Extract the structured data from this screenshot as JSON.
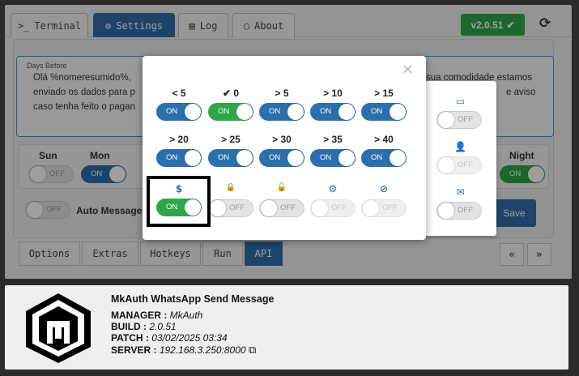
{
  "tabs": [
    {
      "icon": ">_",
      "label": "Terminal"
    },
    {
      "icon": "⚙",
      "label": "Settings"
    },
    {
      "icon": "▤",
      "label": "Log"
    },
    {
      "icon": "◯",
      "label": "About"
    }
  ],
  "version_badge": {
    "label": "v2.0.51",
    "icon": "check-icon",
    "color": "#2ea74a"
  },
  "message": {
    "label": "Days Before",
    "line1": "Olá %nomeresumido%,",
    "line1_right": "sua comodidade estamos",
    "line2": "enviado os dados para p",
    "line2_right": "e aviso",
    "line3": "caso tenha feito o pagan"
  },
  "days": {
    "sun": "Sun",
    "mon": "Mon",
    "night": "Night"
  },
  "toggle_text": {
    "on": "ON",
    "off": "OFF"
  },
  "auto_message_label": "Auto Message",
  "save_label": "Save",
  "bottom_tabs": [
    "Options",
    "Extras",
    "Hotkeys",
    "Run",
    "API"
  ],
  "nav": {
    "prev": "«",
    "next": "»"
  },
  "modal": {
    "close": "×",
    "row1": [
      {
        "arrow": "<",
        "value": "5",
        "state": "on"
      },
      {
        "arrow": "✔",
        "value": "0",
        "state": "green"
      },
      {
        "arrow": ">",
        "value": "5",
        "state": "on"
      },
      {
        "arrow": ">",
        "value": "10",
        "state": "on"
      },
      {
        "arrow": ">",
        "value": "15",
        "state": "on"
      }
    ],
    "row2": [
      {
        "arrow": ">",
        "value": "20",
        "state": "on"
      },
      {
        "arrow": ">",
        "value": "25",
        "state": "on"
      },
      {
        "arrow": ">",
        "value": "30",
        "state": "on"
      },
      {
        "arrow": ">",
        "value": "35",
        "state": "on"
      },
      {
        "arrow": ">",
        "value": "40",
        "state": "on"
      }
    ],
    "row3": [
      {
        "icon": "$",
        "name": "dollar-icon",
        "state": "green"
      },
      {
        "icon": "🔒",
        "name": "lock-icon",
        "state": "off"
      },
      {
        "icon": "🔓",
        "name": "unlock-icon",
        "state": "off"
      },
      {
        "icon": "⚙",
        "name": "gears-icon",
        "state": "off-dim"
      },
      {
        "icon": "⊘",
        "name": "ban-icon",
        "state": "off-dim"
      }
    ]
  },
  "side": [
    {
      "icon": "▭",
      "name": "battery-icon"
    },
    {
      "icon": "👤",
      "name": "user-times-icon"
    },
    {
      "icon": "✉",
      "name": "envelope-icon"
    }
  ],
  "info": {
    "title": "MkAuth WhatsApp Send Message",
    "manager_label": "MANAGER :",
    "manager_value": "MkAuth",
    "build_label": "BUILD :",
    "build_value": "2.0.51",
    "patch_label": "PATCH :",
    "patch_value": "03/02/2025 03:34",
    "server_label": "SERVER :",
    "server_value": "192.168.3.250:8000"
  }
}
